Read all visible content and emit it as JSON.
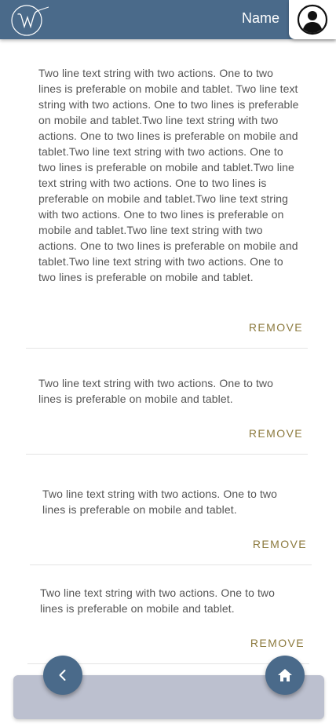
{
  "header": {
    "user_name": "Name",
    "colors": {
      "bar": "#4a6a8a",
      "text": "#ffffff"
    }
  },
  "cards": [
    {
      "text": "Two line text string with two actions. One to two lines is preferable on mobile and tablet. Two line text string with two actions. One to two lines is preferable on mobile and tablet.Two line text string with two actions. One to two lines is preferable on mobile and tablet.Two line text string with two actions. One to two lines is preferable on mobile and tablet.Two line text string with two actions. One to two lines is preferable on mobile and tablet.Two line text string with two actions. One to two lines is preferable on mobile and tablet.Two line text string with two actions. One to two lines is preferable on mobile and tablet.Two line text string with two actions. One to two lines is preferable on mobile and tablet.",
      "remove_label": "REMOVE"
    },
    {
      "text": "Two line text string with two actions. One to two lines is preferable on mobile and tablet.",
      "remove_label": "REMOVE"
    },
    {
      "text": "Two line text string with two actions. One to two lines is preferable on mobile and tablet.",
      "remove_label": "REMOVE"
    },
    {
      "text": "Two line text string with two actions. One to two lines is preferable on mobile and tablet.",
      "remove_label": "REMOVE"
    }
  ],
  "bottom_nav": {
    "back_icon": "chevron-left-icon",
    "home_icon": "home-icon"
  },
  "colors": {
    "accent": "#8c7a3e",
    "fab": "#4a6a8a",
    "bottom_bar": "#bcc0cf"
  }
}
